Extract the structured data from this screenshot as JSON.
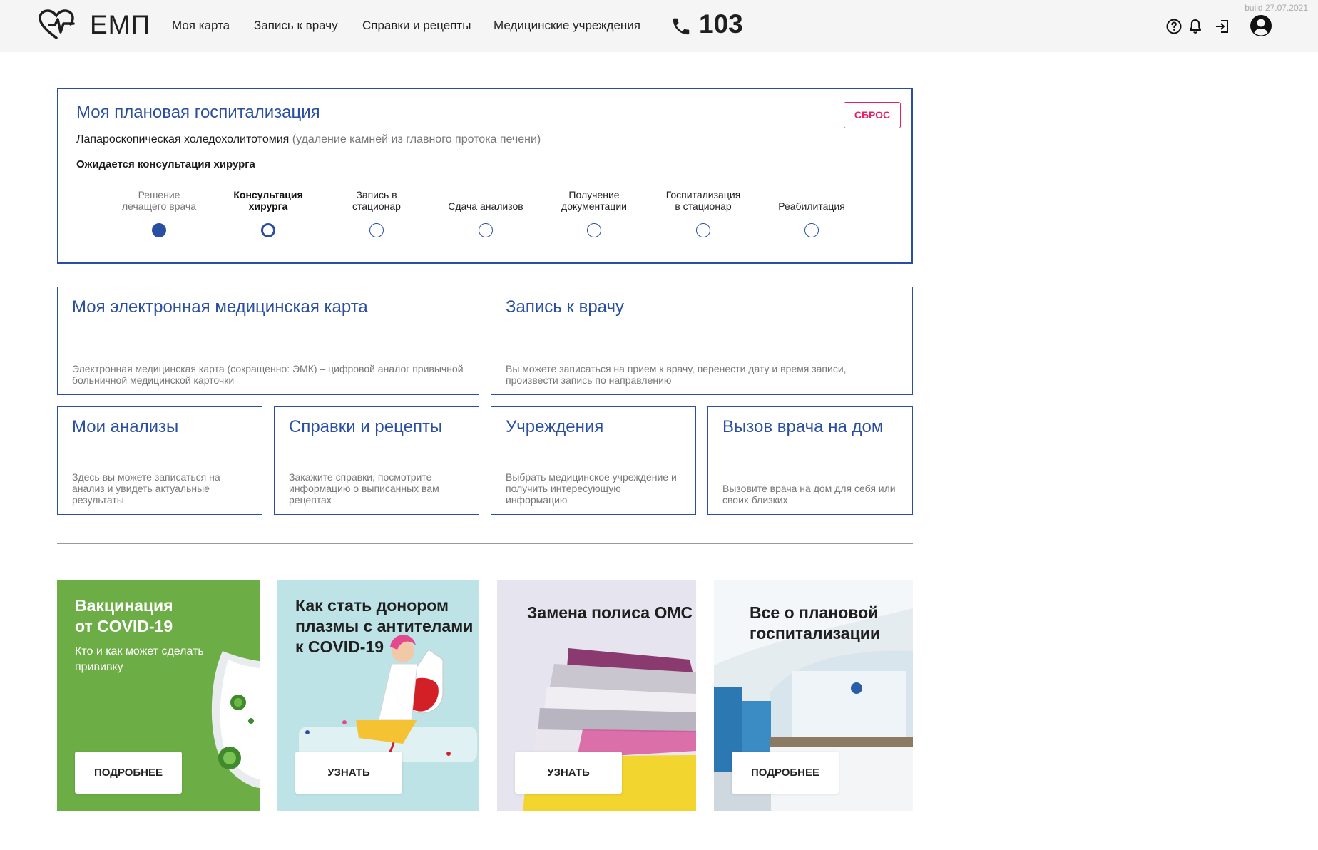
{
  "header": {
    "logo_text": "ЕМП",
    "nav": [
      "Моя карта",
      "Запись к врачу",
      "Справки и рецепты",
      "Медицинские учреждения"
    ],
    "phone": "103",
    "build": "build 27.07.2021",
    "icons": [
      "help-icon",
      "bell-icon",
      "logout-icon",
      "account-icon"
    ]
  },
  "hospitalization": {
    "title": "Моя плановая госпитализация",
    "reset_label": "СБРОС",
    "procedure": "Лапароскопическая холедохолитотомия",
    "procedure_note": "(удаление камней из главного протока печени)",
    "status": "Ожидается консультация хирурга",
    "steps": [
      {
        "l1": "Решение",
        "l2": "лечащего врача",
        "state": "done"
      },
      {
        "l1": "Консультация",
        "l2": "хирурга",
        "state": "current"
      },
      {
        "l1": "Запись в",
        "l2": "стационар",
        "state": "todo"
      },
      {
        "l1": "",
        "l2": "Сдача анализов",
        "state": "todo"
      },
      {
        "l1": "Получение",
        "l2": "документации",
        "state": "todo"
      },
      {
        "l1": "Госпитализация",
        "l2": "в стационар",
        "state": "todo"
      },
      {
        "l1": "",
        "l2": "Реабилитация",
        "state": "todo"
      }
    ]
  },
  "tiles": [
    {
      "title": "Моя электронная медицинская карта",
      "desc": "Электронная медицинская карта (сокращенно: ЭМК) – цифровой аналог привычной больничной медицинской карточки"
    },
    {
      "title": "Запись к врачу",
      "desc": "Вы можете записаться на прием к врачу, перенести дату и время записи, произвести запись по направлению"
    },
    {
      "title": "Мои анализы",
      "desc": "Здесь вы можете записаться на анализ и увидеть актуальные результаты"
    },
    {
      "title": "Справки и рецепты",
      "desc": "Закажите справки, посмотрите информацию о выписанных вам рецептах"
    },
    {
      "title": "Учреждения",
      "desc": "Выбрать медицинское учреждение и получить интересующую информацию"
    },
    {
      "title": "Вызов врача на дом",
      "desc": "Вызовите врача на дом для себя или своих близких"
    }
  ],
  "banners": [
    {
      "title_l1": "Вакцинация",
      "title_l2": "от COVID-19",
      "title_l3": "",
      "sub_l1": "Кто и как может сделать",
      "sub_l2": "прививку",
      "button": "ПОДРОБНЕЕ",
      "bg": "#6cad45"
    },
    {
      "title_l1": "Как стать донором",
      "title_l2": "плазмы с антителами",
      "title_l3": "к COVID-19",
      "button": "УЗНАТЬ",
      "bg": "#bde3e6"
    },
    {
      "title_l1": "Замена полиса ОМС",
      "title_l2": "",
      "title_l3": "",
      "button": "УЗНАТЬ",
      "bg": "#d9d6e4"
    },
    {
      "title_l1": "Все о плановой",
      "title_l2": "госпитализации",
      "title_l3": "",
      "button": "ПОДРОБНЕЕ",
      "bg": "#cfdbe3"
    }
  ],
  "colors": {
    "accent": "#2a4fa2",
    "reset": "#e91e63"
  }
}
